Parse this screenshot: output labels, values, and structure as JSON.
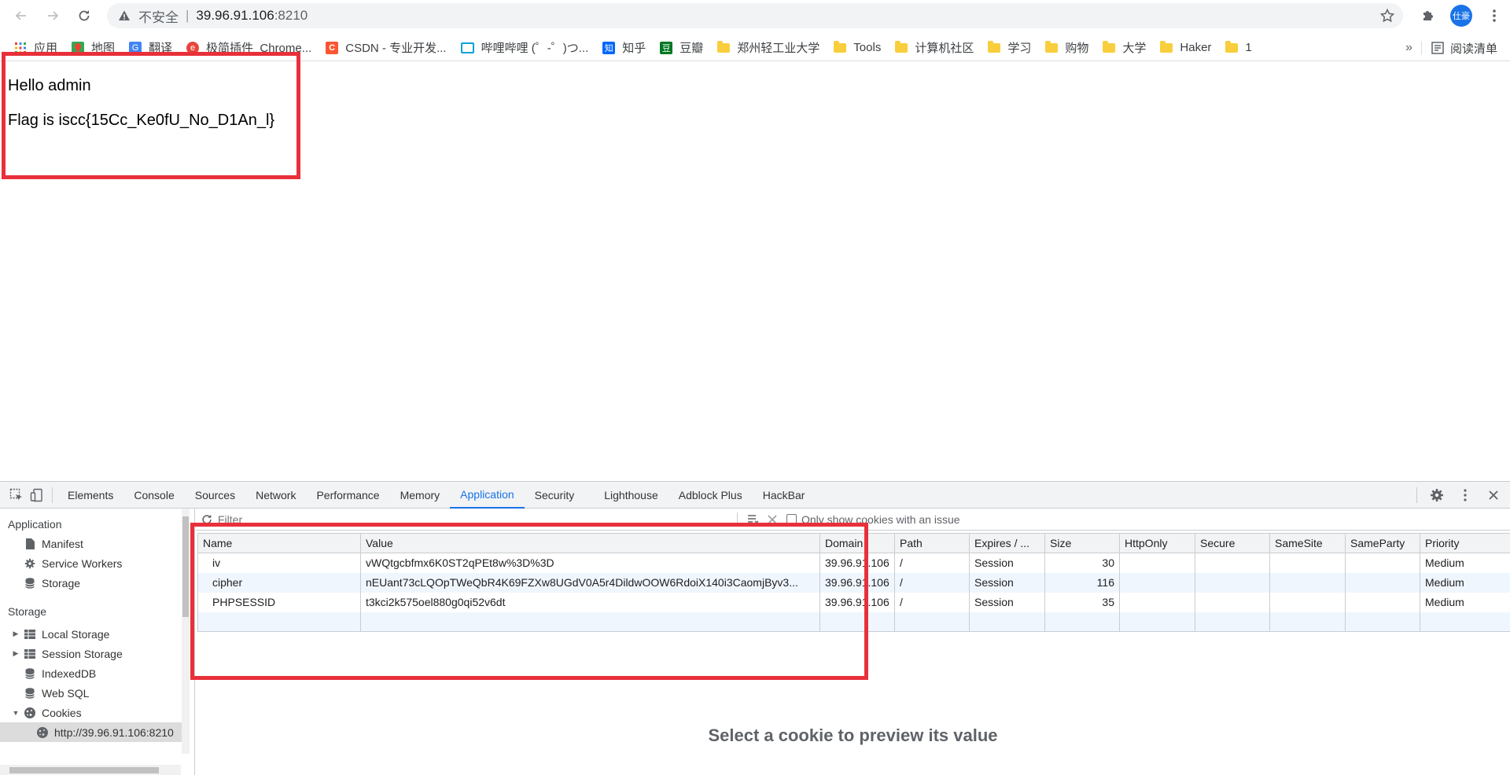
{
  "browser": {
    "insecure_label": "不安全",
    "url_separator": "|",
    "url_host": "39.96.91.106",
    "url_port": ":8210",
    "avatar_text": "仕豪"
  },
  "bookmarks": {
    "items": [
      {
        "label": "应用",
        "icon": "apps-grid-icon"
      },
      {
        "label": "地图",
        "icon": "maps-icon"
      },
      {
        "label": "翻译",
        "icon": "translate-icon"
      },
      {
        "label": "极简插件_Chrome...",
        "icon": "chrome-plugin-icon"
      },
      {
        "label": "CSDN - 专业开发...",
        "icon": "csdn-icon"
      },
      {
        "label": "哔哩哔哩 (゜-゜)つ...",
        "icon": "bilibili-icon"
      },
      {
        "label": "知乎",
        "icon": "zhihu-icon"
      },
      {
        "label": "豆瓣",
        "icon": "douban-icon"
      },
      {
        "label": "郑州轻工业大学",
        "icon": "folder-icon"
      },
      {
        "label": "Tools",
        "icon": "folder-icon"
      },
      {
        "label": "计算机社区",
        "icon": "folder-icon"
      },
      {
        "label": "学习",
        "icon": "folder-icon"
      },
      {
        "label": "购物",
        "icon": "folder-icon"
      },
      {
        "label": "大学",
        "icon": "folder-icon"
      },
      {
        "label": "Haker",
        "icon": "folder-icon"
      },
      {
        "label": "1",
        "icon": "folder-icon"
      }
    ],
    "overflow": "»",
    "reading_list": "阅读清单"
  },
  "page": {
    "hello": "Hello admin",
    "flag": "Flag is iscc{15Cc_Ke0fU_No_D1An_l}"
  },
  "devtools": {
    "tabs": [
      "Elements",
      "Console",
      "Sources",
      "Network",
      "Performance",
      "Memory",
      "Application",
      "Security",
      "Lighthouse",
      "Adblock Plus",
      "HackBar"
    ],
    "active_tab": "Application",
    "sidebar": {
      "application_heading": "Application",
      "application_items": [
        {
          "label": "Manifest",
          "icon": "document-icon"
        },
        {
          "label": "Service Workers",
          "icon": "gear-icon"
        },
        {
          "label": "Storage",
          "icon": "database-icon"
        }
      ],
      "storage_heading": "Storage",
      "storage_items": [
        {
          "label": "Local Storage",
          "icon": "grid-icon",
          "expandable": true
        },
        {
          "label": "Session Storage",
          "icon": "grid-icon",
          "expandable": true
        },
        {
          "label": "IndexedDB",
          "icon": "database-icon",
          "expandable": false
        },
        {
          "label": "Web SQL",
          "icon": "database-icon",
          "expandable": false
        },
        {
          "label": "Cookies",
          "icon": "cookie-icon",
          "expandable": true,
          "expanded": true
        }
      ],
      "cookie_origin": "http://39.96.91.106:8210"
    },
    "filter": {
      "placeholder": "Filter",
      "only_issues_label": "Only show cookies with an issue"
    },
    "columns": [
      "Name",
      "Value",
      "Domain",
      "Path",
      "Expires / ...",
      "Size",
      "HttpOnly",
      "Secure",
      "SameSite",
      "SameParty",
      "Priority"
    ],
    "cookies": [
      {
        "name": "iv",
        "value": "vWQtgcbfmx6K0ST2qPEt8w%3D%3D",
        "domain": "39.96.91.106",
        "path": "/",
        "expires": "Session",
        "size": "30",
        "httponly": "",
        "secure": "",
        "samesite": "",
        "sameparty": "",
        "priority": "Medium"
      },
      {
        "name": "cipher",
        "value": "nEUant73cLQOpTWeQbR4K69FZXw8UGdV0A5r4DildwOOW6RdoiX140i3CaomjByv3...",
        "domain": "39.96.91.106",
        "path": "/",
        "expires": "Session",
        "size": "116",
        "httponly": "",
        "secure": "",
        "samesite": "",
        "sameparty": "",
        "priority": "Medium"
      },
      {
        "name": "PHPSESSID",
        "value": "t3kci2k575oel880g0qi52v6dt",
        "domain": "39.96.91.106",
        "path": "/",
        "expires": "Session",
        "size": "35",
        "httponly": "",
        "secure": "",
        "samesite": "",
        "sameparty": "",
        "priority": "Medium"
      }
    ],
    "preview_message": "Select a cookie to preview its value"
  },
  "colors": {
    "highlight_box": "#e8303a",
    "accent": "#1a73e8"
  }
}
